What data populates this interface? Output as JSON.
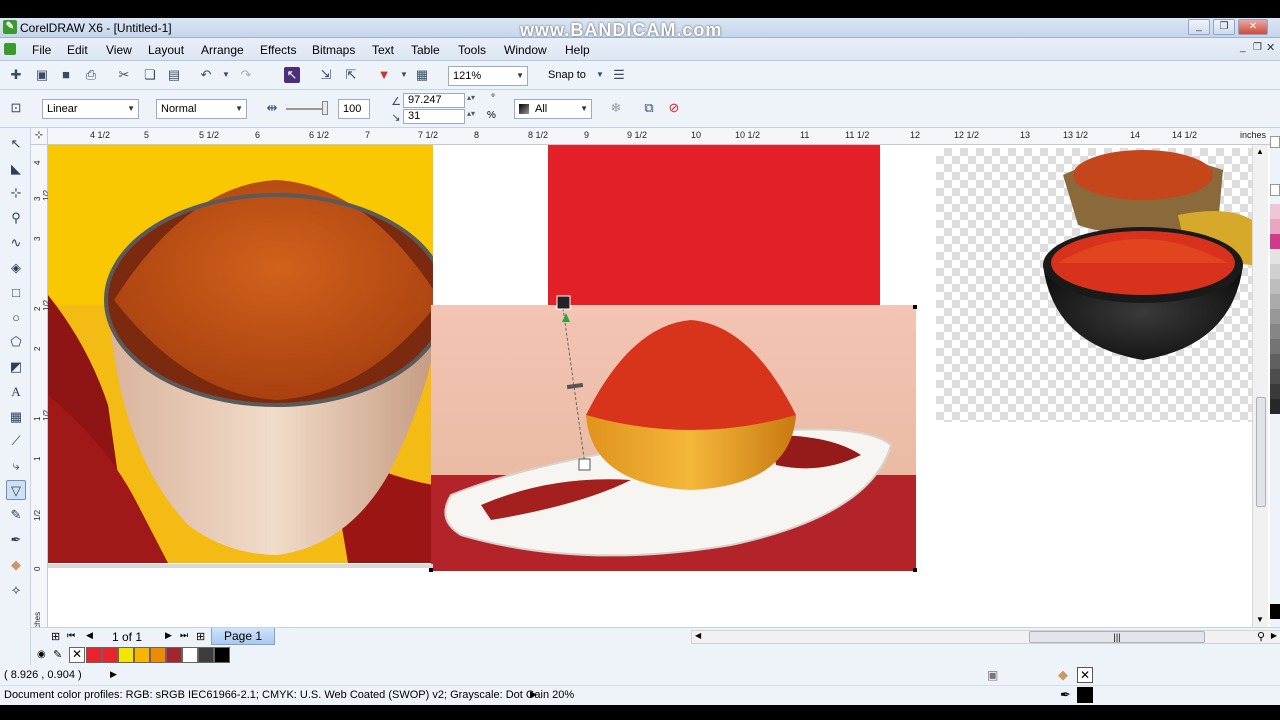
{
  "window": {
    "title": "CorelDRAW X6 - [Untitled-1]",
    "watermark": "www.BANDICAM.com",
    "minimize": "_",
    "restore": "❐",
    "close": "✕"
  },
  "menu": {
    "items": [
      {
        "label": "File"
      },
      {
        "label": "Edit"
      },
      {
        "label": "View"
      },
      {
        "label": "Layout"
      },
      {
        "label": "Arrange"
      },
      {
        "label": "Effects"
      },
      {
        "label": "Bitmaps"
      },
      {
        "label": "Text"
      },
      {
        "label": "Table"
      },
      {
        "label": "Tools"
      },
      {
        "label": "Window"
      },
      {
        "label": "Help"
      }
    ]
  },
  "standard_toolbar": {
    "zoom": "121%",
    "snap_to": "Snap to"
  },
  "property_bar": {
    "transparency_type": "Linear",
    "merge_mode": "Normal",
    "slider_value": "100",
    "angle": "97.247",
    "angle_unit": "°",
    "edge_pad": "31",
    "edge_unit": "%",
    "apply_to": "All"
  },
  "ruler_top": {
    "ticks": [
      "4 1/2",
      "5",
      "5 1/2",
      "6",
      "6 1/2",
      "7",
      "7 1/2",
      "8",
      "8 1/2",
      "9",
      "9 1/2",
      "10",
      "10 1/2",
      "11",
      "11 1/2",
      "12",
      "12 1/2",
      "13",
      "13 1/2",
      "14",
      "14 1/2",
      "inches"
    ]
  },
  "ruler_left": {
    "ticks": [
      "4",
      "3 1/2",
      "3",
      "2 1/2",
      "2",
      "1 1/2",
      "1",
      "1/2",
      "0"
    ],
    "unit": "inches"
  },
  "pagebar": {
    "counter": "1 of 1",
    "page_tab": "Page 1"
  },
  "palette": {
    "colors": [
      "#e8232b",
      "#e8232b",
      "#f5e400",
      "#f7b500",
      "#f08a00",
      "#a3242c",
      "#ffffff",
      "#3c3c3c",
      "#000000"
    ]
  },
  "status": {
    "coords": "( 8.926 , 0.904 )",
    "color_profiles": "Document color profiles: RGB: sRGB IEC61966-2.1; CMYK: U.S. Web Coated (SWOP) v2; Grayscale: Dot Gain 20%"
  },
  "icons": [
    "new-icon",
    "open-icon",
    "save-icon",
    "print-icon",
    "cut-icon",
    "copy-icon",
    "paste-icon",
    "undo-icon",
    "redo-icon",
    "import-icon",
    "export-icon",
    "publish-icon",
    "app-launcher-icon",
    "options-icon",
    "pick-tool-icon",
    "shape-tool-icon",
    "crop-tool-icon",
    "zoom-tool-icon",
    "freehand-tool-icon",
    "smart-fill-icon",
    "rectangle-tool-icon",
    "ellipse-tool-icon",
    "polygon-tool-icon",
    "basic-shapes-icon",
    "text-tool-icon",
    "table-tool-icon",
    "parallel-dimension-icon",
    "connector-icon",
    "transparency-tool-icon",
    "eyedropper-icon",
    "outline-pen-icon",
    "fill-tool-icon",
    "interactive-fill-icon"
  ]
}
